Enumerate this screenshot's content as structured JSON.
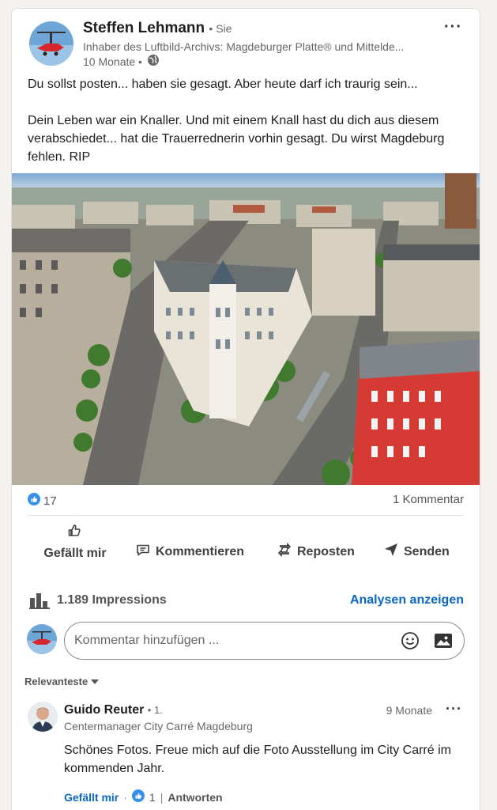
{
  "post": {
    "author_name": "Steffen Lehmann",
    "author_suffix": "• Sie",
    "author_headline": "Inhaber des Luftbild-Archivs: Magdeburger Platte® und Mittelde...",
    "time": "10 Monate •",
    "more": "···",
    "text_lines": [
      "Du sollst posten... haben sie gesagt. Aber heute darf ich traurig sein...",
      "Dein Leben war ein Knaller. Und mit einem Knall hast du dich aus diesem verabschiedet... hat die Trauerrednerin vorhin gesagt. Du wirst Magdeburg fehlen. RIP"
    ],
    "reactions_count": "17",
    "comments_count": "1 Kommentar"
  },
  "actions": {
    "like": "Gefällt mir",
    "comment": "Kommentieren",
    "repost": "Reposten",
    "send": "Senden"
  },
  "analytics": {
    "impressions": "1.189 Impressions",
    "link": "Analysen anzeigen"
  },
  "comment_box": {
    "placeholder": "Kommentar hinzufügen ..."
  },
  "sort_label": "Relevanteste",
  "comment": {
    "name": "Guido Reuter",
    "degree": "• 1.",
    "headline": "Centermanager City Carré Magdeburg",
    "time": "9 Monate",
    "more": "···",
    "text": "Schönes Fotos. Freue mich auf die Foto Ausstellung im City Carré im kommenden Jahr.",
    "like": "Gefällt mir",
    "sep": "·",
    "like_count": "1",
    "divider": "|",
    "reply": "Antworten"
  },
  "colors": {
    "accent": "#0a66c2",
    "text": "#1d1d1d",
    "muted": "#666666"
  }
}
